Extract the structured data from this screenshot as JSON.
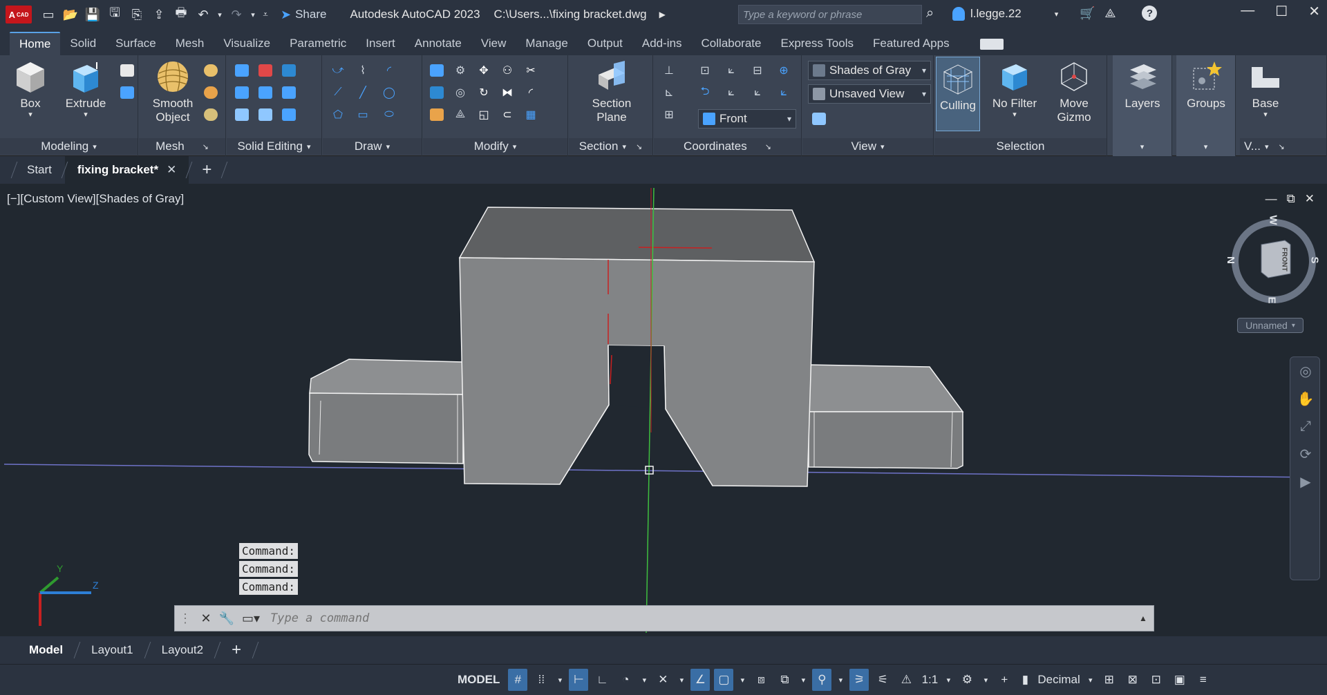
{
  "app": {
    "logo_text": "A",
    "logo_sub": "CAD",
    "title": "Autodesk AutoCAD 2023",
    "file_path": "C:\\Users...\\fixing bracket.dwg",
    "share_label": "Share",
    "search_placeholder": "Type a keyword or phrase",
    "user_name": "l.legge.22"
  },
  "ribbon_tabs": [
    "Home",
    "Solid",
    "Surface",
    "Mesh",
    "Visualize",
    "Parametric",
    "Insert",
    "Annotate",
    "View",
    "Manage",
    "Output",
    "Add-ins",
    "Collaborate",
    "Express Tools",
    "Featured Apps"
  ],
  "panels": {
    "modeling": {
      "title": "Modeling",
      "box": "Box",
      "extrude": "Extrude"
    },
    "mesh": {
      "title": "Mesh",
      "smooth_line1": "Smooth",
      "smooth_line2": "Object"
    },
    "solid_editing": {
      "title": "Solid Editing"
    },
    "draw": {
      "title": "Draw"
    },
    "modify": {
      "title": "Modify"
    },
    "section": {
      "title": "Section",
      "plane_line1": "Section",
      "plane_line2": "Plane"
    },
    "coordinates": {
      "title": "Coordinates"
    },
    "view": {
      "title": "View",
      "visual_style": "Shades of Gray",
      "named_view": "Unsaved View",
      "view_dir": "Front"
    },
    "selection": {
      "title": "Selection",
      "culling": "Culling",
      "no_filter": "No Filter",
      "move_gizmo_line1": "Move",
      "move_gizmo_line2": "Gizmo"
    },
    "layers": {
      "label": "Layers"
    },
    "groups": {
      "label": "Groups"
    },
    "base": {
      "label": "Base",
      "title": "V..."
    }
  },
  "doc_tabs": {
    "start": "Start",
    "active": "fixing bracket*"
  },
  "viewport": {
    "label": "[−][Custom View][Shades of Gray]",
    "viewcube_face": "FRONT",
    "compass": {
      "n": "N",
      "s": "S",
      "w": "W",
      "e": "E"
    },
    "named_ucs": "Unnamed",
    "ucs_axes": {
      "x": "X",
      "y": "Y",
      "z": "Z"
    }
  },
  "command": {
    "history": [
      "Command:",
      "Command:",
      "Command:"
    ],
    "placeholder": "Type a command"
  },
  "layout_tabs": [
    "Model",
    "Layout1",
    "Layout2"
  ],
  "status": {
    "model": "MODEL",
    "scale": "1:1",
    "units": "Decimal"
  },
  "colors": {
    "accent": "#5aa2e6",
    "bg_viewport": "#212830",
    "ribbon": "#3b4453",
    "solid": "#7a7c7e"
  }
}
